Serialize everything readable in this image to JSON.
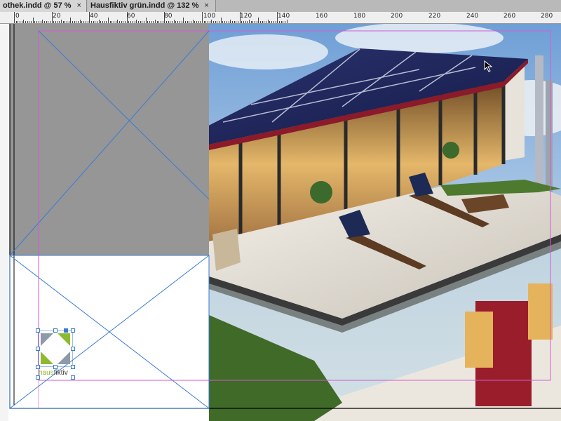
{
  "tabs": [
    {
      "label": "othek.indd @ 57 %",
      "close": "×",
      "active": true
    },
    {
      "label": "Hausfiktiv grün.indd @ 132 %",
      "close": "×",
      "active": false
    }
  ],
  "ruler": {
    "labels": [
      "0",
      "20",
      "40",
      "60",
      "80",
      "100",
      "120",
      "140",
      "160",
      "180",
      "200",
      "220",
      "240",
      "260",
      "280"
    ]
  },
  "logo": {
    "text_part1": "haus",
    "text_part2": "fiktiv"
  },
  "colors": {
    "accent_green": "#8dbb2f",
    "guide_magenta": "#d15bd1",
    "frame_blue": "#3a7bd5"
  }
}
